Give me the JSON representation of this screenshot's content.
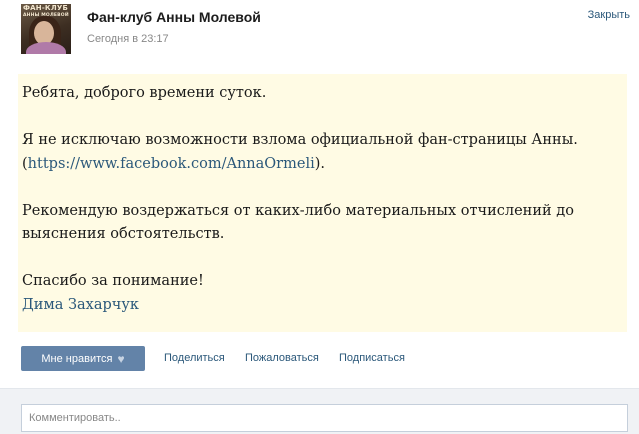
{
  "header": {
    "avatar_text_line1": "ФАН-КЛУБ",
    "avatar_text_line2": "АННЫ МОЛЕВОЙ",
    "group_title": "Фан-клуб Анны Молевой",
    "time": "Сегодня в 23:17",
    "close_label": "Закрыть"
  },
  "post": {
    "line1": "Ребята, доброго времени суток.",
    "line2": "Я не исключаю возможности взлома официальной фан-страницы Анны.",
    "line3_prefix": "(",
    "line3_link": "https://www.facebook.com/AnnaOrmeli",
    "line3_suffix": ").",
    "line4": "Рекомендую воздержаться от каких-либо материальных отчислений до",
    "line5": "выяснения обстоятельств.",
    "line6": "Спасибо за понимание!",
    "signature": "Дима Захарчук",
    "background_color": "#fffbe4"
  },
  "actions": {
    "like_label": "Мне нравится",
    "like_icon": "heart-icon",
    "share_label": "Поделиться",
    "report_label": "Пожаловаться",
    "subscribe_label": "Подписаться",
    "accent_color": "#6383a8",
    "link_color": "#2b587a"
  },
  "comment": {
    "placeholder": "Комментировать.."
  }
}
